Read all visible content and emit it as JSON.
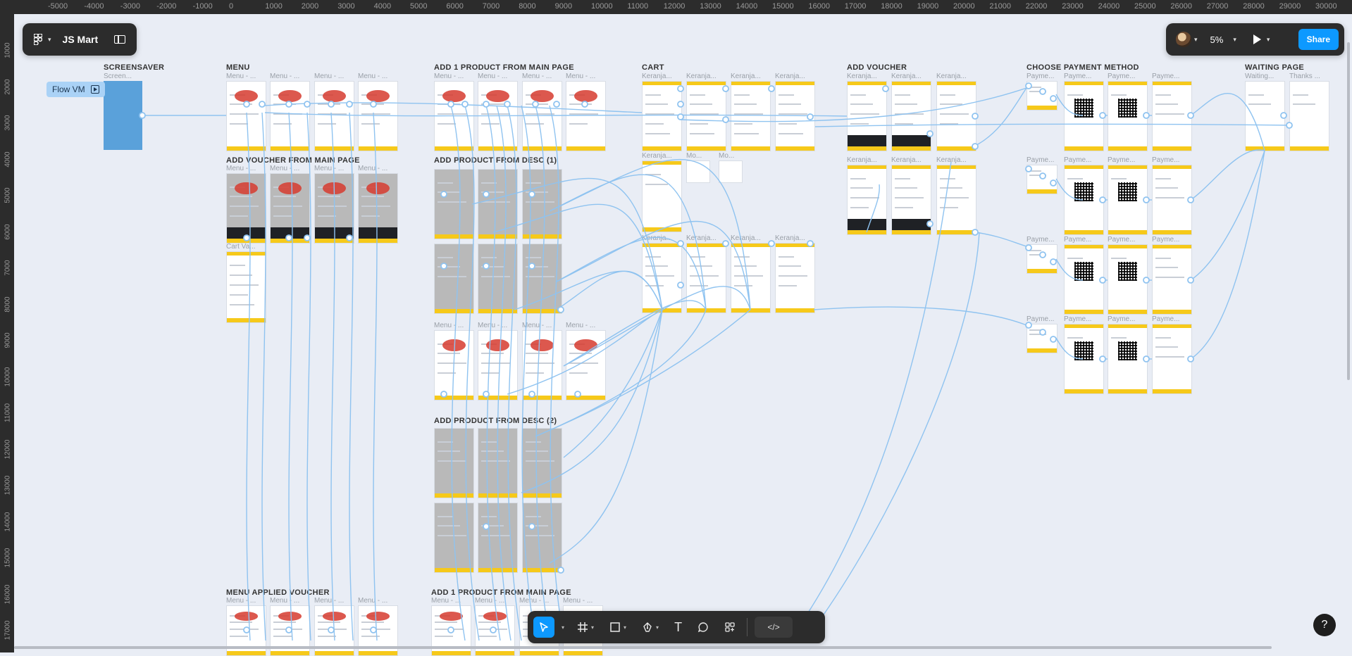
{
  "app": {
    "file_title": "JS Mart",
    "zoom": "5%",
    "share_label": "Share"
  },
  "ruler": {
    "x_ticks": [
      "-5000",
      "-4000",
      "-3000",
      "-2000",
      "-1000",
      "0",
      "1000",
      "2000",
      "3000",
      "4000",
      "5000",
      "6000",
      "7000",
      "8000",
      "9000",
      "10000",
      "11000",
      "12000",
      "13000",
      "14000",
      "15000",
      "16000",
      "17000",
      "18000",
      "19000",
      "20000",
      "21000",
      "22000",
      "23000",
      "24000",
      "25000",
      "26000",
      "27000",
      "28000",
      "29000",
      "30000"
    ],
    "y_ticks": [
      "1000",
      "2000",
      "3000",
      "4000",
      "5000",
      "6000",
      "7000",
      "8000",
      "9000",
      "10000",
      "11000",
      "12000",
      "13000",
      "14000",
      "15000",
      "16000",
      "17000"
    ]
  },
  "flow": {
    "name": "Flow VM"
  },
  "sections": {
    "screensaver": "SCREENSAVER",
    "menu": "MENU",
    "add_1_product_main": "ADD 1 PRODUCT FROM MAIN PAGE",
    "cart": "CART",
    "add_voucher": "ADD VOUCHER",
    "choose_payment": "CHOOSE PAYMENT METHOD",
    "waiting_page": "WAITING PAGE",
    "add_voucher_main": "ADD VOUCHER FROM MAIN PAGE",
    "add_product_desc_1": "ADD PRODUCT FROM DESC (1)",
    "add_product_desc_2": "ADD PRODUCT FROM DESC (2)",
    "menu_applied_voucher": "MENU APPLIED VOUCHER",
    "add_1_product_main_2": "ADD 1 PRODUCT FROM MAIN PAGE"
  },
  "frame_labels": {
    "screensaver": "Screen...",
    "menu": "Menu - ...",
    "cart": "Keranja...",
    "cart_mo": "Mo...",
    "voucher": "Keranja...",
    "payment": "Payme...",
    "waiting": "Waiting...",
    "thanks": "Thanks ...",
    "cart_voucher": "Cart Va..."
  },
  "toolbar": {
    "move": "move-tool",
    "frame": "frame-tool",
    "shape": "rectangle-tool",
    "pen": "pen-tool",
    "text": "T",
    "comment": "comment-tool",
    "actions": "actions-tool",
    "dev": "</>"
  },
  "help_label": "?",
  "colors": {
    "accent": "#0d99ff",
    "flow_line": "#8fc3f0",
    "canvas": "#e9edf5",
    "screensaver": "#5aa1da",
    "header_yellow": "#f6c91a"
  }
}
